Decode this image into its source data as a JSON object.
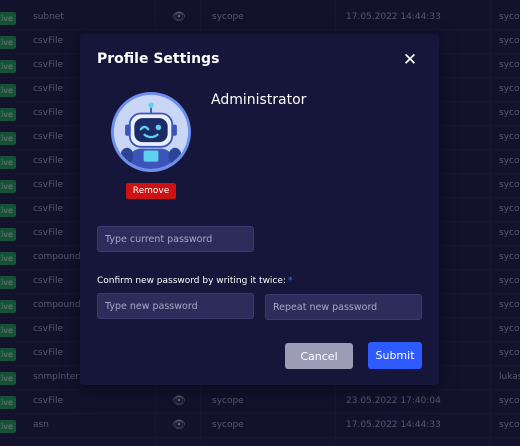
{
  "background_table": {
    "status_label": "ive",
    "rows": [
      {
        "name": "subnet",
        "owner": "sycope",
        "date": "17.05.2022 14:44:33",
        "user": "sycop"
      },
      {
        "name": "csvFile",
        "owner": "",
        "date": "",
        "user": "sycop"
      },
      {
        "name": "csvFile",
        "owner": "",
        "date": "",
        "user": "sycop"
      },
      {
        "name": "csvFile",
        "owner": "",
        "date": "",
        "user": "sycop"
      },
      {
        "name": "csvFile",
        "owner": "",
        "date": "",
        "user": "sycop"
      },
      {
        "name": "csvFile",
        "owner": "",
        "date": "",
        "user": "sycop"
      },
      {
        "name": "csvFile",
        "owner": "",
        "date": "",
        "user": "sycop"
      },
      {
        "name": "csvFile",
        "owner": "",
        "date": "",
        "user": "sycop"
      },
      {
        "name": "csvFile",
        "owner": "",
        "date": "",
        "user": "sycop"
      },
      {
        "name": "csvFile",
        "owner": "",
        "date": "",
        "user": "sycop"
      },
      {
        "name": "compound",
        "owner": "",
        "date": "",
        "user": "sycop"
      },
      {
        "name": "csvFile",
        "owner": "",
        "date": "",
        "user": "sycop"
      },
      {
        "name": "compound",
        "owner": "",
        "date": "",
        "user": "sycop"
      },
      {
        "name": "csvFile",
        "owner": "",
        "date": "",
        "user": "sycop"
      },
      {
        "name": "csvFile",
        "owner": "",
        "date": "",
        "user": "sycop"
      },
      {
        "name": "snmpInterfa",
        "owner": "",
        "date": "",
        "user": "lukas"
      },
      {
        "name": "csvFile",
        "owner": "sycope",
        "date": "23.05.2022 17:40:04",
        "user": "sycop"
      },
      {
        "name": "asn",
        "owner": "sycope",
        "date": "17.05.2022 14:44:33",
        "user": "sycop"
      }
    ]
  },
  "modal": {
    "title": "Profile Settings",
    "close_icon": "close-icon",
    "avatar_icon": "robot-avatar",
    "user_name": "Administrator",
    "remove_label": "Remove",
    "current_password_placeholder": "Type current password",
    "confirm_label": "Confirm new password by writing it twice:",
    "required_mark": "*",
    "new_password_placeholder": "Type new password",
    "repeat_password_placeholder": "Repeat new password",
    "cancel_label": "Cancel",
    "submit_label": "Submit"
  },
  "colors": {
    "status_green": "#27ae60",
    "remove_red": "#cc1212",
    "submit_blue": "#2e5bff",
    "cancel_gray": "#9c9cb6"
  }
}
